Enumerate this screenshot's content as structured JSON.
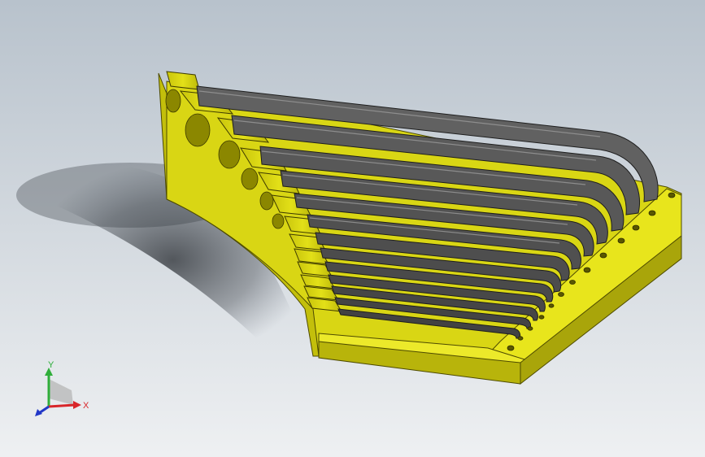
{
  "viewport": {
    "background_top": "#b8c2cc",
    "background_bottom": "#eef0f2"
  },
  "model": {
    "tray_color": "#e3e018",
    "tray_dark": "#6f6a00",
    "tray_shadow": "#a39f0a",
    "key_color": "#5e5e5e",
    "key_dark": "#2a2a2a",
    "key_light": "#8a8a8a",
    "slot_count": 13
  },
  "triad": {
    "x_label": "X",
    "y_label": "Y",
    "z_label": "Z",
    "x_color": "#d8262a",
    "y_color": "#2fae3a",
    "z_color": "#2137c7"
  }
}
